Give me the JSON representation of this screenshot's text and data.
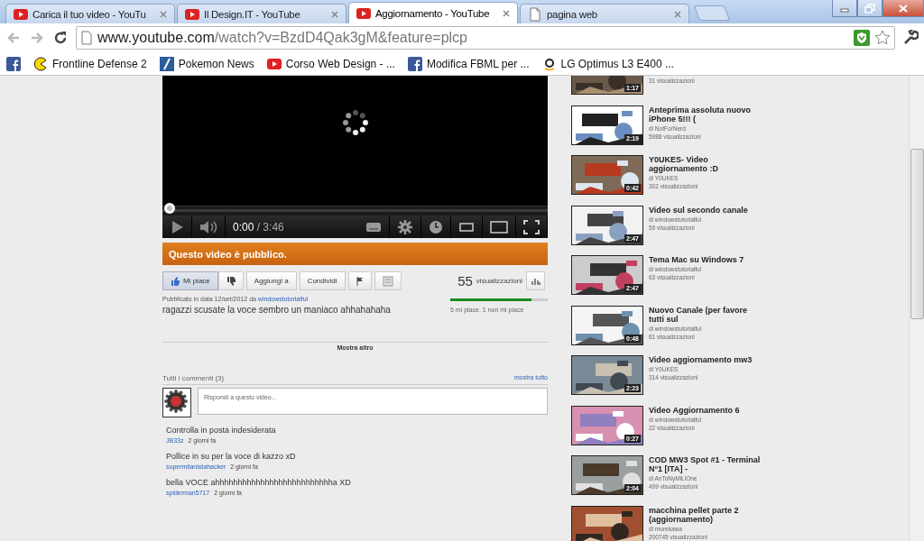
{
  "browser": {
    "tabs": [
      {
        "title": "Carica il tuo video - YouTu",
        "selected": false
      },
      {
        "title": "Il Design.IT - YouTube",
        "selected": false
      },
      {
        "title": "Aggiornamento - YouTube",
        "selected": true
      },
      {
        "title": "pagina web",
        "selected": false
      }
    ],
    "address": {
      "host": "www.youtube.com",
      "path": "/watch?v=BzdD4Qak3gM&feature=plcp"
    },
    "bookmarks": [
      {
        "label": "Frontline Defense 2"
      },
      {
        "label": "Pokemon News"
      },
      {
        "label": "Corso Web Design - ..."
      },
      {
        "label": "Modifica FBML per ..."
      },
      {
        "label": "LG Optimus L3 E400 ..."
      }
    ]
  },
  "player": {
    "loading": true,
    "level": 0,
    "time": "0:00",
    "duration": "/ 3:46"
  },
  "notice": "Questo video è pubblico.",
  "actions": [
    {
      "kind": "like",
      "label": "Mi piace"
    },
    {
      "kind": "dislike"
    },
    {
      "kind": "text",
      "label": "Aggiungi a"
    },
    {
      "kind": "text",
      "label": "Condividi"
    },
    {
      "kind": "flag"
    },
    {
      "kind": "transcript"
    }
  ],
  "views": {
    "count": "55",
    "label": "visualizzazioni",
    "likes": {
      "level": 0.83,
      "text": "5 mi piace, 1 non mi piace"
    }
  },
  "description": {
    "published": "Pubblicato in data 12/set/2012 da",
    "author": "windowstutorialful",
    "text": "ragazzi scusate la voce sembro un maniaco ahhahahaha",
    "more": "Mostra altro"
  },
  "comments": {
    "title": "Tutti i commenti (3)",
    "show_all": "mostra tutto",
    "placeholder": "Rispondi a questo video...",
    "items": [
      {
        "text": "Controlla in posta indesiderata",
        "author": "JB33z",
        "age": "2 giorni fa"
      },
      {
        "text": "Pollice in su per la voce di kazzo xD",
        "author": "supermilanistahacker",
        "age": "2 giorni fa"
      },
      {
        "text": "bella VOCE ahhhhhhhhhhhhhhhhhhhhhhhhhha XD",
        "author": "spiderman5717",
        "age": "2 giorni fa"
      }
    ]
  },
  "related": [
    {
      "views": "31 visualizzazioni",
      "duration": "1:17"
    },
    {
      "title": "Anteprima assoluta nuovo iPhone 5!!! (",
      "channel": "di NotForNerd",
      "views": "5988 visualizzazioni",
      "duration": "2:19"
    },
    {
      "title": "Y0UKES- Video aggiornamento :D",
      "channel": "di Y0UKES",
      "views": "302 visualizzazioni",
      "duration": "0:42"
    },
    {
      "title": "Video sul secondo canale",
      "channel": "di windowstutorialful",
      "views": "59 visualizzazioni",
      "duration": "2:47"
    },
    {
      "title": "Tema Mac su Windows 7",
      "channel": "di windowstutorialful",
      "views": "63 visualizzazioni",
      "duration": "2:47"
    },
    {
      "title": "Nuovo Canale (per favore tutti sul",
      "channel": "di windowstutorialful",
      "views": "61 visualizzazioni",
      "duration": "0:48"
    },
    {
      "title": "Video aggiornamento mw3",
      "channel": "di Y0UKES",
      "views": "314 visualizzazioni",
      "duration": "2:23"
    },
    {
      "title": "Video Aggiornamento 6",
      "channel": "di windowstutorialful",
      "views": "22 visualizzazioni",
      "duration": "0:27"
    },
    {
      "title": "COD MW3 Spot #1 - Terminal N°1 [ITA] -",
      "channel": "di AnToNyMiLiOne",
      "views": "499 visualizzazioni",
      "duration": "2:04"
    },
    {
      "title": "macchina pellet parte 2 (aggiornamento)",
      "channel": "di murekawa",
      "views": "200745 visualizzazioni"
    }
  ]
}
